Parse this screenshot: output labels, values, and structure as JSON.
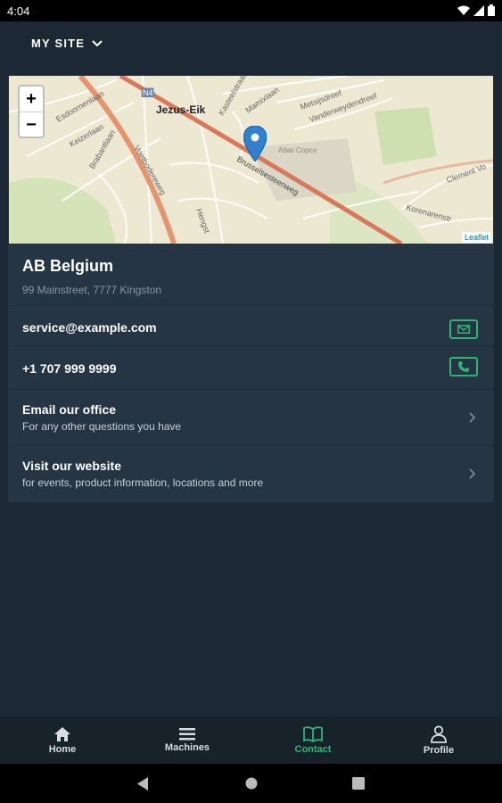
{
  "status_bar": {
    "time": "4:04"
  },
  "header": {
    "site_selector": "MY SITE"
  },
  "map": {
    "zoom_in": "+",
    "zoom_out": "−",
    "attribution": "Leaflet",
    "labels": {
      "jezus_eik": "Jezus-Eik",
      "n4": "N4",
      "atlas_copco": "Atlas Copco",
      "brusselsesteenweg": "Brusselsesteenweg",
      "esdoornenlaan": "Esdoornenlaan",
      "keizerlaan": "Keizerlaan",
      "brabantlaan": "Brabantlaan",
      "kasteelstraat": "Kasteelstraat",
      "mamixlaan": "Mamixlaan",
      "metsijsdreef": "Metsijsdreef",
      "vandewyerdreef": "Vanderweydendreef",
      "clement": "Clement Vo",
      "korenarenstr": "Korenarenstr",
      "hengst": "Hengst",
      "voetbodereweg": "Voetbodereweg"
    }
  },
  "company": {
    "name": "AB Belgium",
    "address": "99 Mainstreet, 7777 Kingston"
  },
  "contact": {
    "email": "service@example.com",
    "phone": "+1 707 999 9999",
    "email_office_title": "Email our office",
    "email_office_sub": "For any other questions you have",
    "website_title": "Visit our website",
    "website_sub": "for events, product information, locations and more"
  },
  "nav": {
    "home": "Home",
    "machines": "Machines",
    "contact": "Contact",
    "profile": "Profile"
  },
  "colors": {
    "accent": "#2bb673",
    "background": "#1c2833",
    "card": "#253543"
  }
}
